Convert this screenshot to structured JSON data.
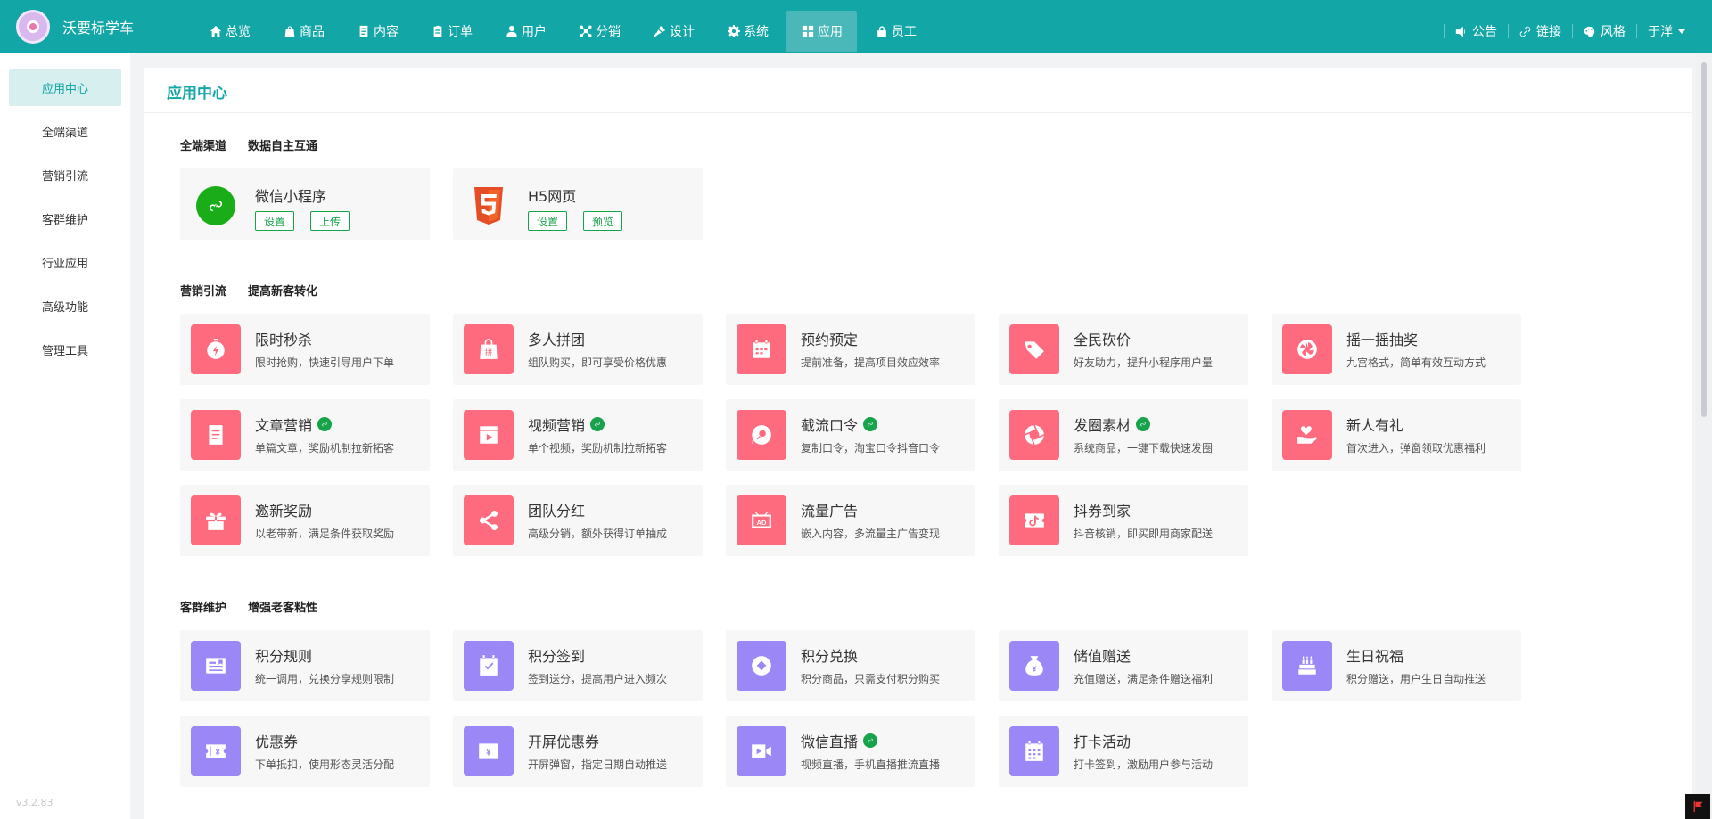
{
  "brand": {
    "name": "沃要标学车"
  },
  "nav": [
    {
      "label": "总览",
      "icon": "home-icon"
    },
    {
      "label": "商品",
      "icon": "bag-icon"
    },
    {
      "label": "内容",
      "icon": "doc-icon"
    },
    {
      "label": "订单",
      "icon": "clipboard-icon"
    },
    {
      "label": "用户",
      "icon": "user-icon"
    },
    {
      "label": "分销",
      "icon": "share-icon"
    },
    {
      "label": "设计",
      "icon": "brush-icon"
    },
    {
      "label": "系统",
      "icon": "gear-icon"
    },
    {
      "label": "应用",
      "icon": "grid-icon",
      "active": true
    },
    {
      "label": "员工",
      "icon": "lock-icon"
    }
  ],
  "tools": {
    "notice": "公告",
    "link": "链接",
    "style": "风格",
    "user": "于洋"
  },
  "sidebar": {
    "items": [
      "应用中心",
      "全端渠道",
      "营销引流",
      "客群维护",
      "行业应用",
      "高级功能",
      "管理工具"
    ],
    "version": "v3.2.83"
  },
  "page_title": "应用中心",
  "channels": {
    "heading": "全端渠道",
    "sub": "数据自主互通",
    "items": [
      {
        "title": "微信小程序",
        "buttons": [
          "设置",
          "上传"
        ]
      },
      {
        "title": "H5网页",
        "buttons": [
          "设置",
          "预览"
        ]
      }
    ]
  },
  "marketing": {
    "heading": "营销引流",
    "sub": "提高新客转化",
    "items": [
      {
        "title": "限时秒杀",
        "desc": "限时抢购，快速引导用户下单",
        "icon": "stopwatch-icon",
        "mini": false
      },
      {
        "title": "多人拼团",
        "desc": "组队购买，即可享受价格优惠",
        "icon": "group-bag-icon",
        "mini": false
      },
      {
        "title": "预约预定",
        "desc": "提前准备，提高项目效应效率",
        "icon": "calendar-icon",
        "mini": false
      },
      {
        "title": "全民砍价",
        "desc": "好友助力，提升小程序用户量",
        "icon": "tag-cut-icon",
        "mini": false
      },
      {
        "title": "摇一摇抽奖",
        "desc": "九宫格式，简单有效互动方式",
        "icon": "wheel-icon",
        "mini": false
      },
      {
        "title": "文章营销",
        "desc": "单篇文章，奖励机制拉新拓客",
        "icon": "article-icon",
        "mini": true
      },
      {
        "title": "视频营销",
        "desc": "单个视频，奖励机制拉新拓客",
        "icon": "video-icon",
        "mini": true
      },
      {
        "title": "截流口令",
        "desc": "复制口令，淘宝口令抖音口令",
        "icon": "search-bubble-icon",
        "mini": true
      },
      {
        "title": "发圈素材",
        "desc": "系统商品，一键下载快速发圈",
        "icon": "aperture-icon",
        "mini": true
      },
      {
        "title": "新人有礼",
        "desc": "首次进入，弹窗领取优惠福利",
        "icon": "heart-hand-icon",
        "mini": false
      },
      {
        "title": "邀新奖励",
        "desc": "以老带新，满足条件获取奖励",
        "icon": "gift-icon",
        "mini": false
      },
      {
        "title": "团队分红",
        "desc": "高级分销，额外获得订单抽成",
        "icon": "share-nodes-icon",
        "mini": false
      },
      {
        "title": "流量广告",
        "desc": "嵌入内容，多流量主广告变现",
        "icon": "ad-icon",
        "mini": false
      },
      {
        "title": "抖券到家",
        "desc": "抖音核销，即买即用商家配送",
        "icon": "douyin-ticket-icon",
        "mini": false
      }
    ]
  },
  "retention": {
    "heading": "客群维护",
    "sub": "增强老客粘性",
    "items": [
      {
        "title": "积分规则",
        "desc": "统一调用，兑换分享规则限制",
        "icon": "rule-card-icon",
        "mini": false
      },
      {
        "title": "积分签到",
        "desc": "签到送分，提高用户进入频次",
        "icon": "checkin-icon",
        "mini": false
      },
      {
        "title": "积分兑换",
        "desc": "积分商品，只需支付积分购买",
        "icon": "diamond-coin-icon",
        "mini": false
      },
      {
        "title": "储值赠送",
        "desc": "充值赠送，满足条件赠送福利",
        "icon": "money-bag-icon",
        "mini": false
      },
      {
        "title": "生日祝福",
        "desc": "积分赠送，用户生日自动推送",
        "icon": "cake-icon",
        "mini": false
      },
      {
        "title": "优惠券",
        "desc": "下单抵扣，使用形态灵活分配",
        "icon": "coupon-icon",
        "mini": false
      },
      {
        "title": "开屏优惠券",
        "desc": "开屏弹窗，指定日期自动推送",
        "icon": "screen-coupon-icon",
        "mini": false
      },
      {
        "title": "微信直播",
        "desc": "视频直播，手机直播推流直播",
        "icon": "live-icon",
        "mini": true
      },
      {
        "title": "打卡活动",
        "desc": "打卡签到，激励用户参与活动",
        "icon": "calendar-grid-icon",
        "mini": false
      }
    ]
  },
  "colors": {
    "brand": "#13a6a6",
    "pink": "#fe6b7f",
    "purple": "#9b87f5",
    "mini_green": "#17a34a"
  }
}
